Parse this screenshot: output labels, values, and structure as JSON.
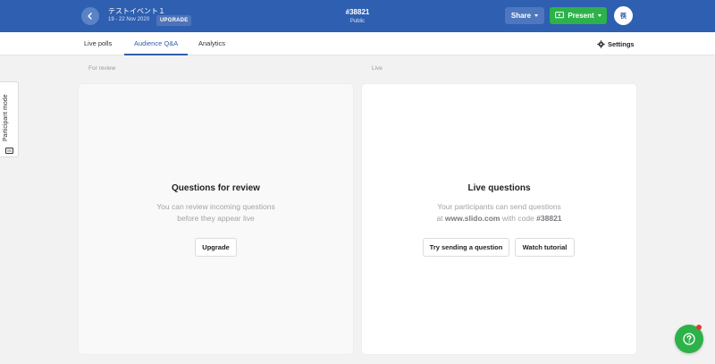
{
  "header": {
    "event_title": "テストイベント１",
    "event_dates": "19 - 22 Nov 2020",
    "upgrade_badge": "UPGRADE",
    "event_code": "#38821",
    "visibility": "Public",
    "share_label": "Share",
    "present_label": "Present",
    "avatar_initial": "筷"
  },
  "tabs": [
    {
      "label": "Live polls",
      "active": false
    },
    {
      "label": "Audience Q&A",
      "active": true
    },
    {
      "label": "Analytics",
      "active": false
    }
  ],
  "settings_label": "Settings",
  "sections": {
    "review_label": "For review",
    "live_label": "Live"
  },
  "review_panel": {
    "title": "Questions for review",
    "desc_line1": "You can review incoming questions",
    "desc_line2": "before they appear live",
    "button": "Upgrade"
  },
  "live_panel": {
    "title": "Live questions",
    "desc_line1": "Your participants can send questions",
    "desc_prefix": "at",
    "desc_site": "www.slido.com",
    "desc_middle": "with code",
    "desc_code": "#38821",
    "button_try": "Try sending a question",
    "button_tutorial": "Watch tutorial"
  },
  "participant_mode_label": "Participant mode",
  "icons": {
    "back": "chevron-left-icon",
    "present": "present-screen-icon",
    "settings": "gear-icon",
    "participant": "monitor-icon",
    "help": "question-circle-icon"
  },
  "colors": {
    "brand_blue": "#2f5fb0",
    "present_green": "#2db24a",
    "notification_red": "#e03a2f"
  }
}
